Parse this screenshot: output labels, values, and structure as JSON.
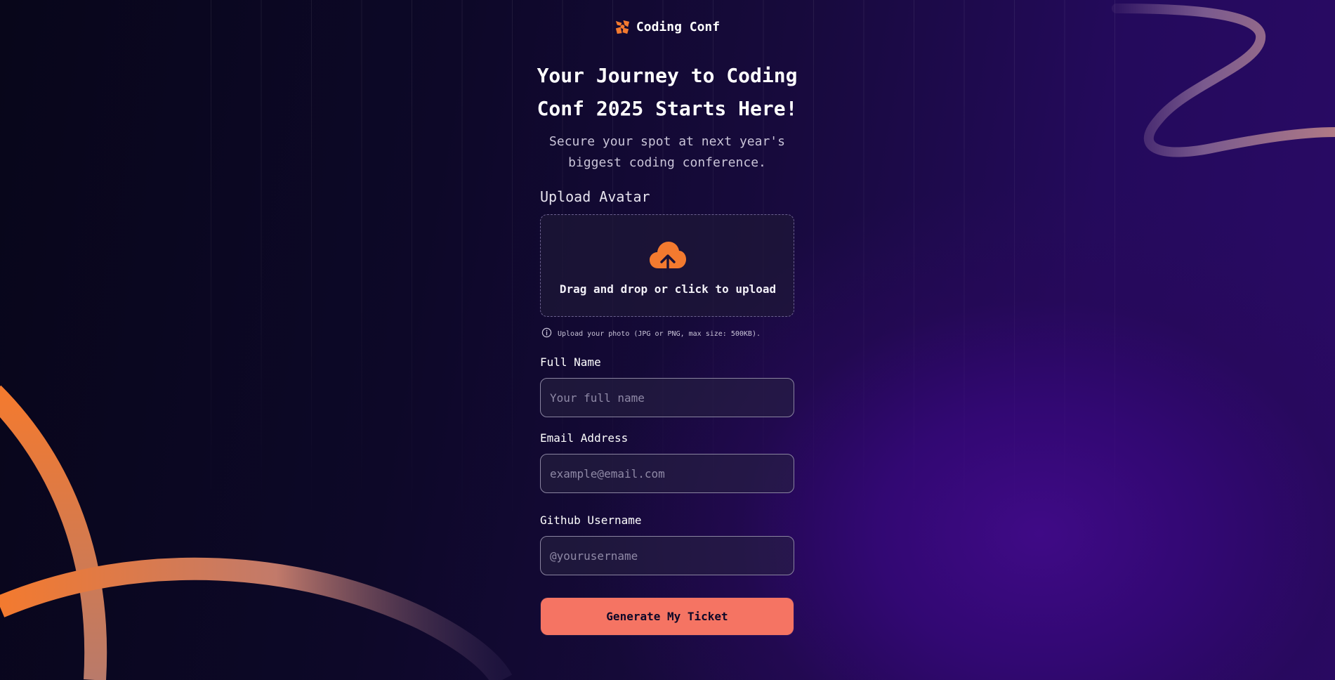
{
  "brand": {
    "logo_icon": "coding-conf-logo-icon",
    "name": "Coding Conf"
  },
  "hero": {
    "title": "Your Journey to Coding Conf 2025 Starts Here!",
    "subtitle": "Secure your spot at next year's biggest coding conference."
  },
  "upload": {
    "label": "Upload Avatar",
    "icon": "cloud-upload-icon",
    "dropzone_text": "Drag and drop or click to upload",
    "hint_icon": "info-icon",
    "hint": "Upload your photo (JPG or PNG, max size: 500KB)."
  },
  "form": {
    "full_name": {
      "label": "Full Name",
      "value": "",
      "placeholder": "Your full name"
    },
    "email": {
      "label": "Email Address",
      "value": "",
      "placeholder": "example@email.com"
    },
    "github": {
      "label": "Github Username",
      "value": "",
      "placeholder": "@yourusername"
    },
    "submit_label": "Generate My Ticket"
  },
  "colors": {
    "accent": "#f57463",
    "brand_orange": "#f37a2f",
    "background_dark": "#0d0828",
    "background_purple": "#3f0a86"
  }
}
